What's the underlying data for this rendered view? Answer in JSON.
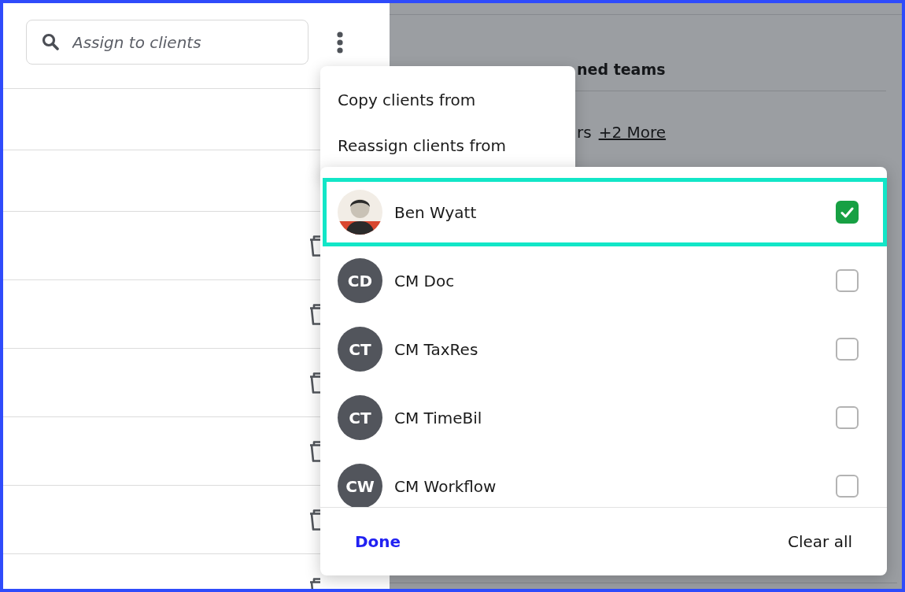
{
  "search": {
    "placeholder": "Assign to clients"
  },
  "client_rows": [
    {
      "kind": "blank"
    },
    {
      "kind": "blank"
    },
    {
      "kind": "removable"
    },
    {
      "kind": "removable"
    },
    {
      "kind": "removable"
    },
    {
      "kind": "removable"
    },
    {
      "kind": "removable"
    },
    {
      "kind": "removable"
    }
  ],
  "background_panel": {
    "heading": "ned teams",
    "members_text": "rs",
    "more_link": "+2 More"
  },
  "actions_menu": {
    "items": [
      "Copy clients from",
      "Reassign clients from"
    ]
  },
  "client_picker": {
    "options": [
      {
        "kind": "photo",
        "name": "Ben Wyatt",
        "checked": true,
        "highlighted": true
      },
      {
        "kind": "initials",
        "initials": "CD",
        "name": "CM Doc",
        "checked": false,
        "highlighted": false
      },
      {
        "kind": "initials",
        "initials": "CT",
        "name": "CM TaxRes",
        "checked": false,
        "highlighted": false
      },
      {
        "kind": "initials",
        "initials": "CT",
        "name": "CM TimeBil",
        "checked": false,
        "highlighted": false
      },
      {
        "kind": "initials",
        "initials": "CW",
        "name": "CM Workflow",
        "checked": false,
        "highlighted": false
      }
    ],
    "buttons": [
      {
        "kind": "primary",
        "label": "Done"
      },
      {
        "kind": "plain",
        "label": "Clear all"
      }
    ]
  }
}
